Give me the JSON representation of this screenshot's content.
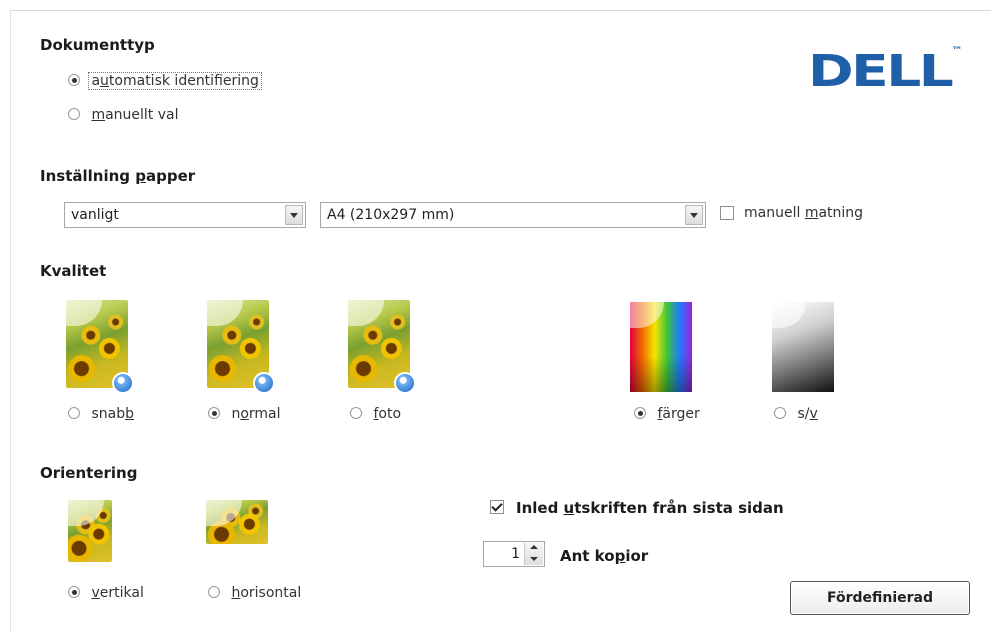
{
  "logo": {
    "text": "DELL",
    "tm": "™",
    "color": "#1e5fa8"
  },
  "document_type": {
    "heading": "Dokumenttyp",
    "options": [
      {
        "pre": "a",
        "ul": "u",
        "post": "tomatisk identifiering",
        "selected": true
      },
      {
        "pre": "",
        "ul": "m",
        "post": "anuellt val",
        "selected": false
      }
    ]
  },
  "paper": {
    "heading_pre": "Inställning ",
    "heading_ul": "p",
    "heading_post": "apper",
    "type_value": "vanligt",
    "size_value": "A4 (210x297 mm)",
    "manual_feed": {
      "pre": "manuell ",
      "ul": "m",
      "post": "atning",
      "checked": false
    }
  },
  "quality": {
    "heading": "Kvalitet",
    "options": [
      {
        "pre": "snab",
        "ul": "b",
        "post": "",
        "selected": false
      },
      {
        "pre": "n",
        "ul": "o",
        "post": "rmal",
        "selected": true
      },
      {
        "pre": "",
        "ul": "f",
        "post": "oto",
        "selected": false
      }
    ],
    "color_options": [
      {
        "pre": "",
        "ul": "f",
        "post": "ärger",
        "selected": true
      },
      {
        "pre": "s/",
        "ul": "v",
        "post": "",
        "selected": false
      }
    ]
  },
  "orientation": {
    "heading": "Orientering",
    "options": [
      {
        "pre": "",
        "ul": "v",
        "post": "ertikal",
        "selected": true
      },
      {
        "pre": "",
        "ul": "h",
        "post": "orisontal",
        "selected": false
      }
    ]
  },
  "reverse_print": {
    "pre": "Inled ",
    "ul": "u",
    "post": "tskriften från sista sidan",
    "checked": true
  },
  "copies": {
    "value": "1",
    "label_pre": "Ant ko",
    "label_ul": "p",
    "label_post": "ior"
  },
  "preset_button": {
    "label": "Fördefinierad"
  }
}
